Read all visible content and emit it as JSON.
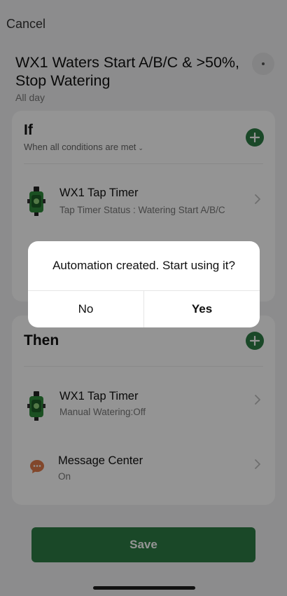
{
  "header": {
    "cancel_label": "Cancel",
    "title": "WX1 Waters Start A/B/C & >50%, Stop Watering",
    "subtitle": "All day",
    "more_icon": "more-horizontal-icon"
  },
  "if_section": {
    "title": "If",
    "condition_mode": "When all conditions are met",
    "conditions": [
      {
        "name": "WX1 Tap Timer",
        "detail": "Tap Timer Status : Watering Start A/B/C",
        "icon": "tap-timer-icon"
      }
    ]
  },
  "then_section": {
    "title": "Then",
    "actions": [
      {
        "name": "WX1 Tap Timer",
        "detail": "Manual Watering:Off",
        "icon": "tap-timer-icon"
      },
      {
        "name": "Message Center",
        "detail": "On",
        "icon": "message-icon"
      }
    ]
  },
  "footer": {
    "save_label": "Save"
  },
  "dialog": {
    "message": "Automation created. Start using it?",
    "no_label": "No",
    "yes_label": "Yes"
  },
  "colors": {
    "accent": "#2e7d45",
    "message_icon": "#e07a4a",
    "background": "#f2f2f3"
  }
}
